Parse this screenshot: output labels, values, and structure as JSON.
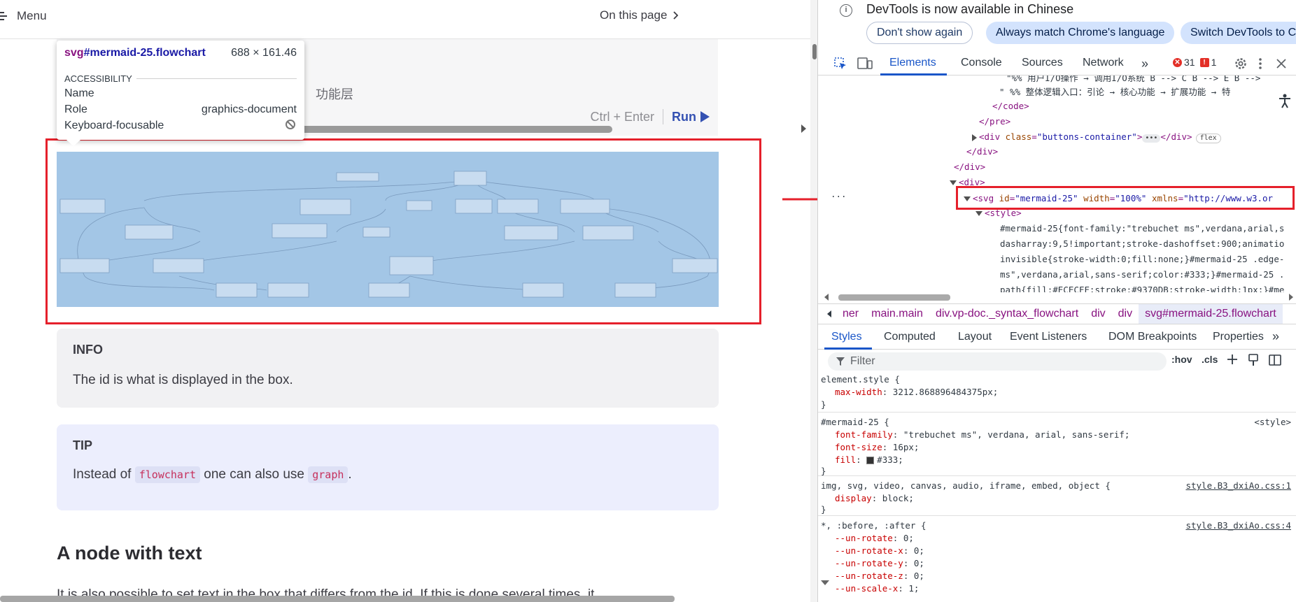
{
  "docs": {
    "menu_label": "Menu",
    "on_this_page_label": "On this page",
    "code_line": "功能层",
    "shortcut": "Ctrl + Enter",
    "run_label": "Run",
    "info_title": "INFO",
    "info_text": "The id is what is displayed in the box.",
    "tip_title": "TIP",
    "tip_text_before": "Instead of",
    "tip_code_1": "flowchart",
    "tip_text_middle": "one can also use",
    "tip_code_2": "graph",
    "tip_text_after": ".",
    "section_title": "A node with text",
    "section_text": "It is also possible to set text in the box that differs from the id. If this is done several times, it"
  },
  "inspect_tooltip": {
    "tag": "svg",
    "id": "#mermaid-25.flowchart",
    "size": "688 × 161.46",
    "section": "ACCESSIBILITY",
    "rows": [
      {
        "label": "Name",
        "value": ""
      },
      {
        "label": "Role",
        "value": "graphics-document"
      },
      {
        "label": "Keyboard-focusable",
        "value": ""
      }
    ]
  },
  "devtools": {
    "banner": {
      "message": "DevTools is now available in Chinese",
      "dont_show": "Don't show again",
      "match": "Always match Chrome's language",
      "switch": "Switch DevTools to Ch"
    },
    "tabs": [
      "Elements",
      "Console",
      "Sources",
      "Network"
    ],
    "errors": "31",
    "warnings": "1",
    "tree": {
      "line1": "\"%% 用户I/O操作 → 调用I/O系统 B --> C B --> E B -->",
      "line2": "\" %% 整体逻辑入口：引论 → 核心功能 → 扩展功能 → 特",
      "code_close": "</code>",
      "pre_close": "</pre>",
      "div_tag": "div",
      "buttons_attr": "class",
      "buttons_val": "\"buttons-container\"",
      "flex_badge": "flex",
      "div_close_1": "</div>",
      "div_close_2": "</div>",
      "div_open": "<div>",
      "svg_tag": "svg",
      "svg_id_attr": "id",
      "svg_id_val": "\"mermaid-25\"",
      "svg_width_attr": "width",
      "svg_width_val": "\"100%\"",
      "svg_xmlns_attr": "xmlns",
      "svg_xmlns_val": "\"http://www.w3.or",
      "style_open": "<style>",
      "css_1": "#mermaid-25{font-family:\"trebuchet ms\",verdana,arial,s",
      "css_2": "dasharray:9,5!important;stroke-dashoffset:900;animatio",
      "css_3": "invisible{stroke-width:0;fill:none;}#mermaid-25 .edge-",
      "css_4": "ms\",verdana,arial,sans-serif;color:#333;}#mermaid-25 .",
      "css_5": "path{fill:#ECECFF;stroke:#9370DB;stroke-width:1px;}#me",
      "dots": "..."
    },
    "breadcrumbs": [
      "ner",
      "main.main",
      "div.vp-doc._syntax_flowchart",
      "div",
      "div",
      "svg#mermaid-25.flowchart"
    ],
    "styles_tabs": [
      "Styles",
      "Computed",
      "Layout",
      "Event Listeners",
      "DOM Breakpoints",
      "Properties"
    ],
    "filter_placeholder": "Filter",
    "hov": ":hov",
    "cls": ".cls",
    "rules": {
      "element_style": {
        "selector": "element.style {",
        "prop": "max-width",
        "value": "3212.868896484375px;"
      },
      "mermaid": {
        "selector": "#mermaid-25 {",
        "source": "<style>",
        "props": [
          {
            "prop": "font-family",
            "value": "\"trebuchet ms\", verdana, arial, sans-serif;"
          },
          {
            "prop": "font-size",
            "value": "16px;"
          },
          {
            "prop": "fill",
            "value": "#333;"
          }
        ]
      },
      "img": {
        "selector": "img, svg, video, canvas, audio, iframe, embed, object {",
        "source": "style.B3_dxiAo.css:1",
        "prop": "display",
        "value": "block;"
      },
      "star": {
        "selector": "*, :before, :after {",
        "source": "style.B3_dxiAo.css:4",
        "props": [
          {
            "prop": "--un-rotate",
            "value": "0;"
          },
          {
            "prop": "--un-rotate-x",
            "value": "0;"
          },
          {
            "prop": "--un-rotate-y",
            "value": "0;"
          },
          {
            "prop": "--un-rotate-z",
            "value": "0;"
          },
          {
            "prop": "--un-scale-x",
            "value": "1;"
          }
        ]
      },
      "close": "}"
    }
  }
}
